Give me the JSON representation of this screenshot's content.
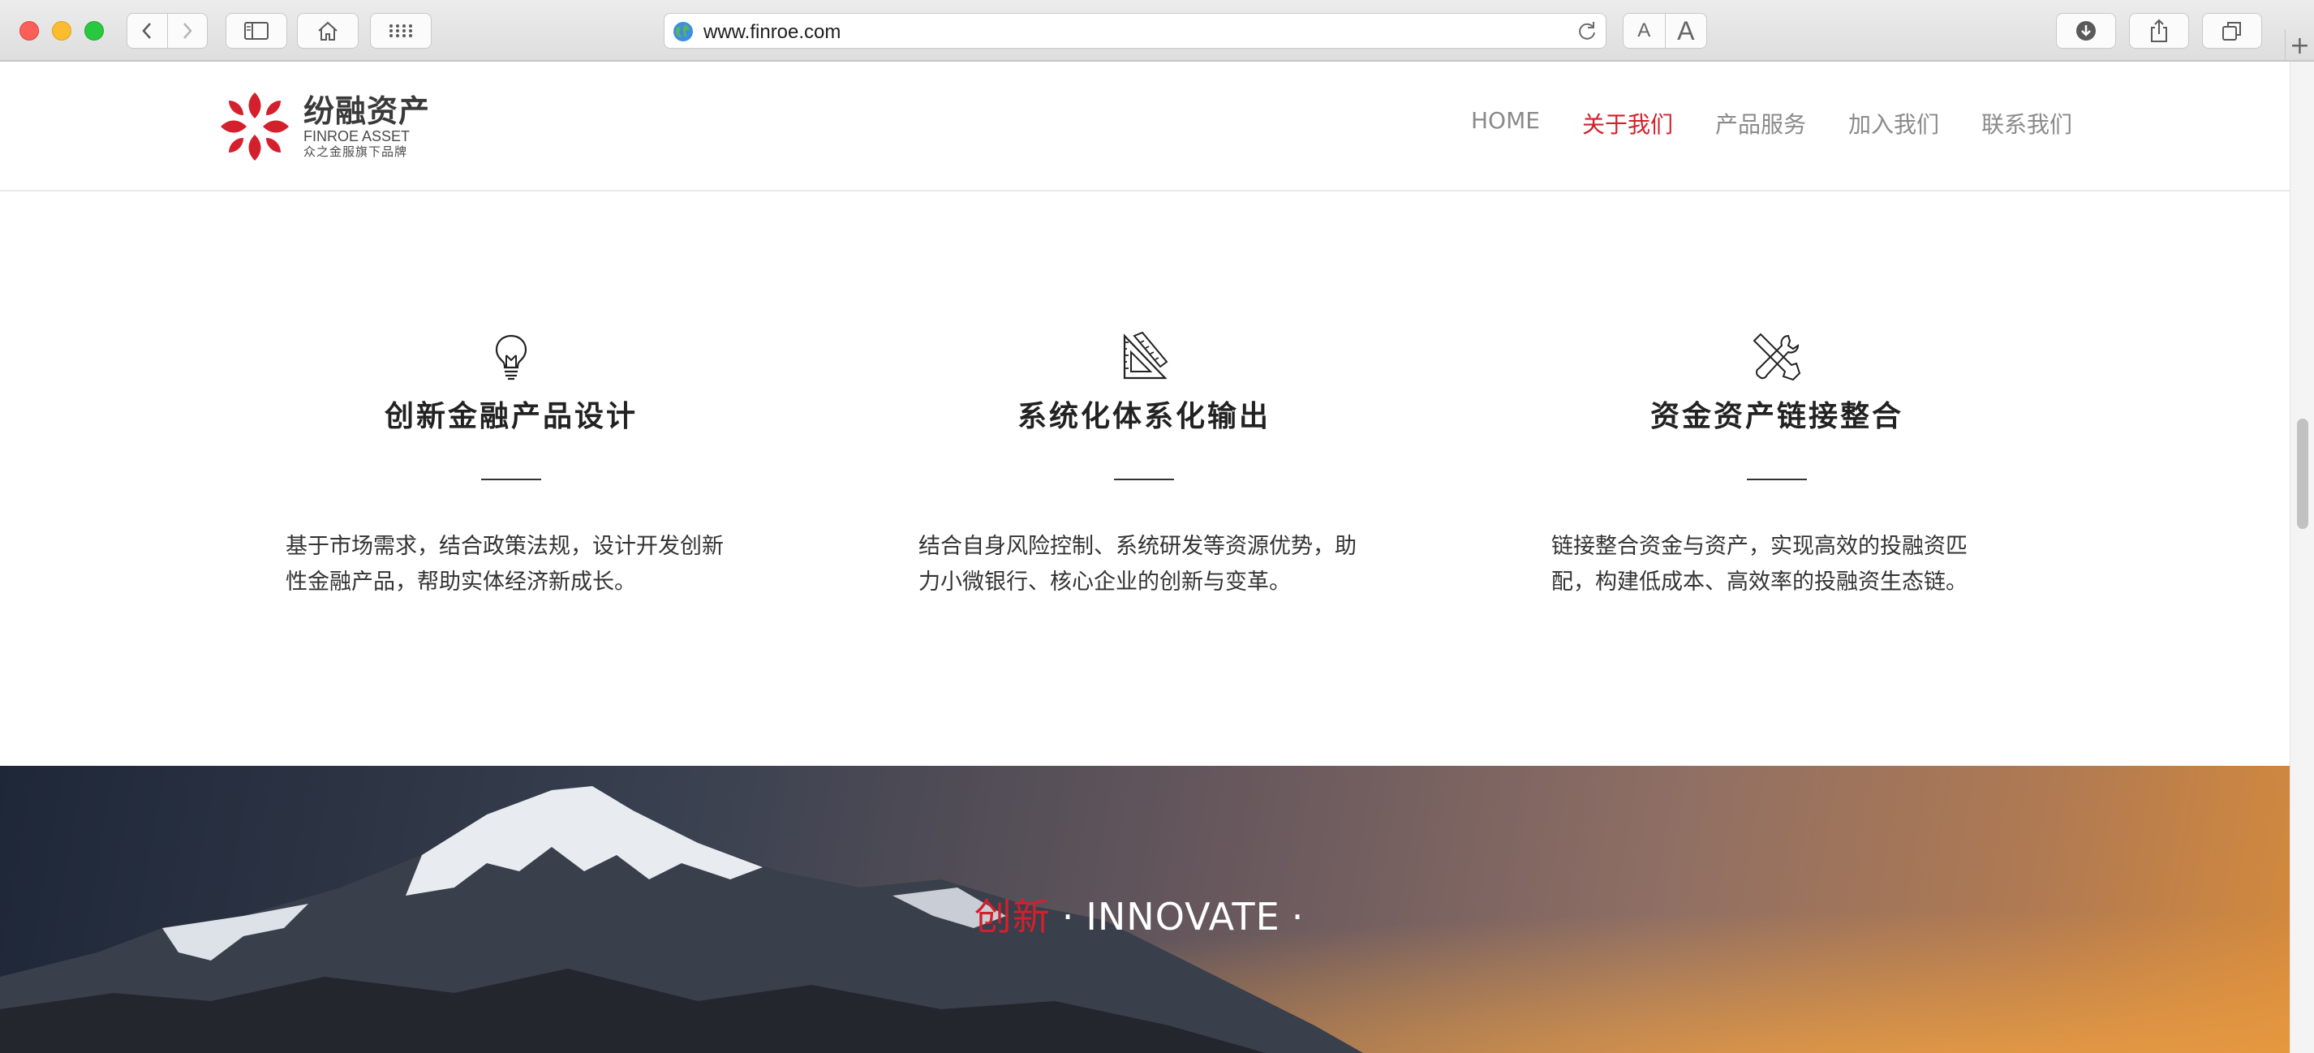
{
  "browser": {
    "url": "www.finroe.com",
    "font_small": "A",
    "font_large": "A",
    "new_tab": "+"
  },
  "header": {
    "logo": {
      "name_cn": "纷融资产",
      "name_en": "FINROE ASSET",
      "tagline": "众之金服旗下品牌"
    },
    "nav": [
      {
        "label": "HOME",
        "active": false
      },
      {
        "label": "关于我们",
        "active": true
      },
      {
        "label": "产品服务",
        "active": false
      },
      {
        "label": "加入我们",
        "active": false
      },
      {
        "label": "联系我们",
        "active": false
      }
    ]
  },
  "features": [
    {
      "icon": "lightbulb-icon",
      "title": "创新金融产品设计",
      "description": "基于市场需求，结合政策法规，设计开发创新性金融产品，帮助实体经济新成长。"
    },
    {
      "icon": "ruler-triangle-icon",
      "title": "系统化体系化输出",
      "description": "结合自身风险控制、系统研发等资源优势，助力小微银行、核心企业的创新与变革。"
    },
    {
      "icon": "tools-icon",
      "title": "资金资产链接整合",
      "description": "链接整合资金与资产，实现高效的投融资匹配，构建低成本、高效率的投融资生态链。"
    }
  ],
  "hero": {
    "title_cn": "创新",
    "separator": "·",
    "title_en": "INNOVATE",
    "trailing": "·"
  },
  "colors": {
    "brand_red": "#d41f2c",
    "nav_gray": "#8a8a8a"
  }
}
